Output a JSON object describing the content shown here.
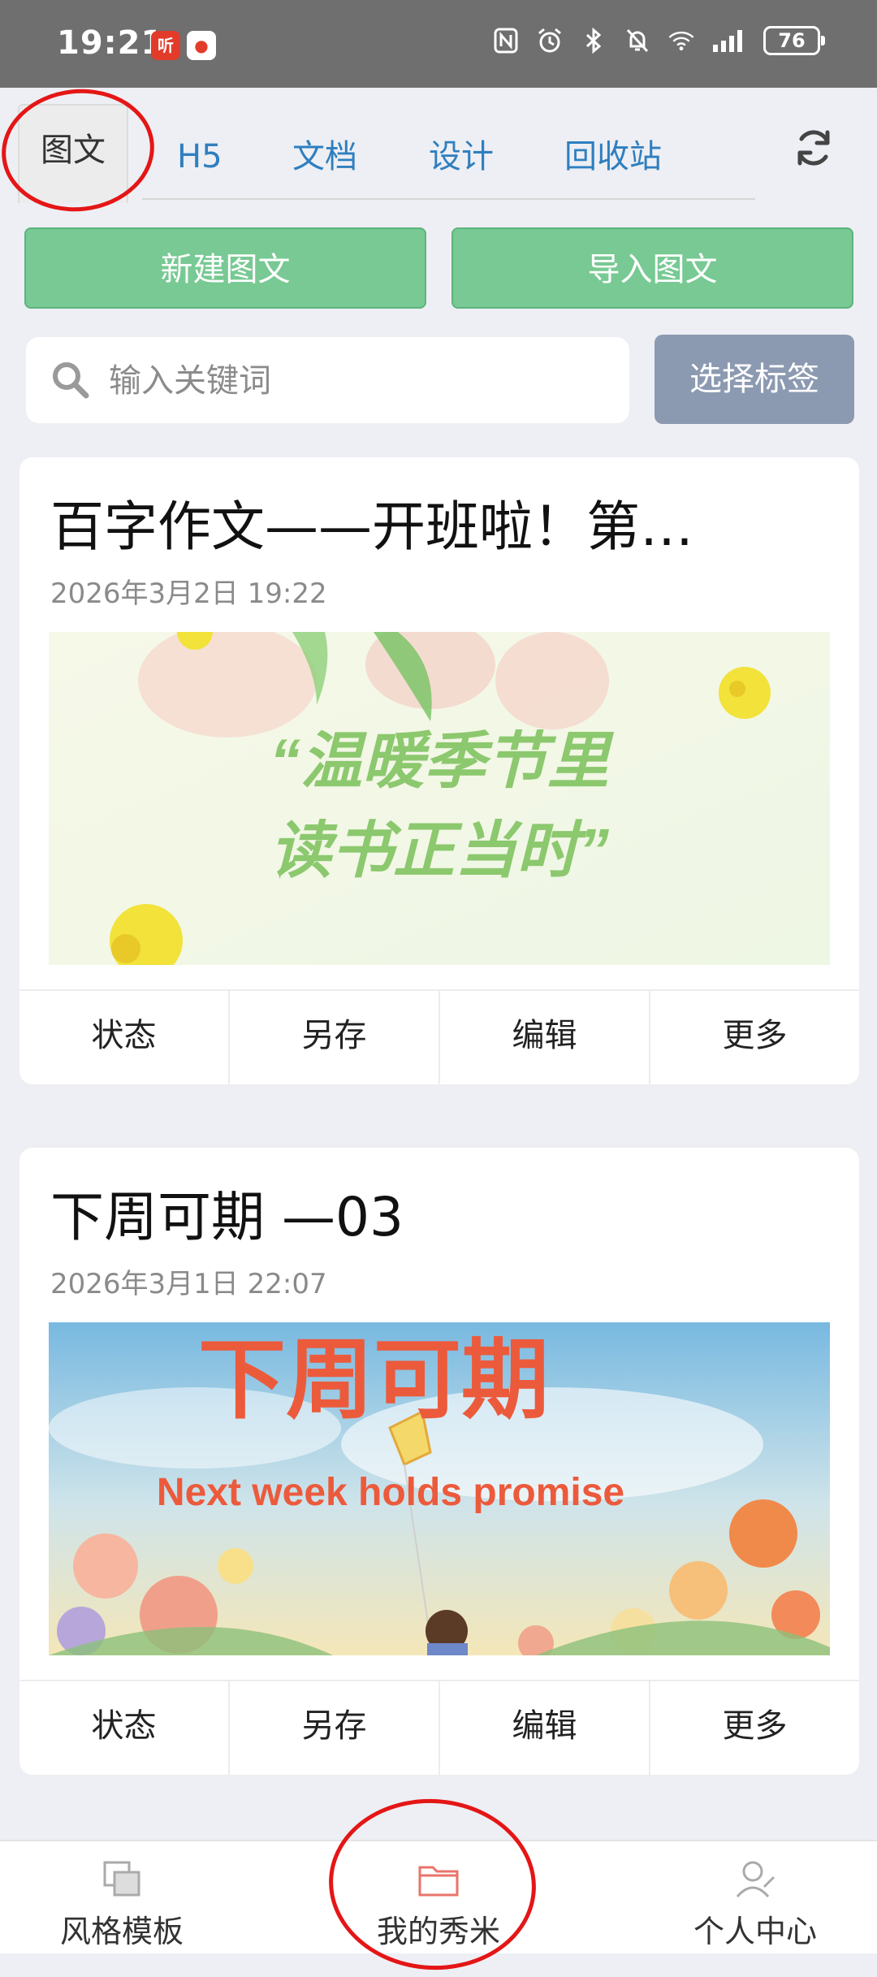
{
  "status_bar": {
    "time": "19:21",
    "battery": "76",
    "app_badges": [
      "听",
      "●"
    ]
  },
  "tabs": [
    {
      "label": "图文",
      "active": true
    },
    {
      "label": "H5",
      "active": false
    },
    {
      "label": "文档",
      "active": false
    },
    {
      "label": "设计",
      "active": false
    },
    {
      "label": "回收站",
      "active": false
    }
  ],
  "buttons": {
    "new_post": "新建图文",
    "import_post": "导入图文",
    "select_tags": "选择标签"
  },
  "search": {
    "placeholder": "输入关键词",
    "value": ""
  },
  "posts": [
    {
      "title": "百字作文——开班啦！第…",
      "date": "2026年3月2日 19:22",
      "cover_text_line1": "“温暖季节里",
      "cover_text_line2": "读书正当时”",
      "actions": [
        "状态",
        "另存",
        "编辑",
        "更多"
      ]
    },
    {
      "title": "下周可期 —03",
      "date": "2026年3月1日 22:07",
      "cover_text_line1": "下周可期",
      "cover_text_line2": "Next week holds promise",
      "actions": [
        "状态",
        "另存",
        "编辑",
        "更多"
      ]
    }
  ],
  "bottom_nav": [
    {
      "label": "风格模板",
      "icon": "template-icon",
      "active": false
    },
    {
      "label": "我的秀米",
      "icon": "folder-icon",
      "active": true
    },
    {
      "label": "个人中心",
      "icon": "user-icon",
      "active": false
    }
  ],
  "colors": {
    "tab_accent": "#2f7fbf",
    "green_button": "#78c993",
    "tag_button": "#8c9ab1",
    "nav_active": "#e8746a",
    "annotation_red": "#e41616"
  }
}
